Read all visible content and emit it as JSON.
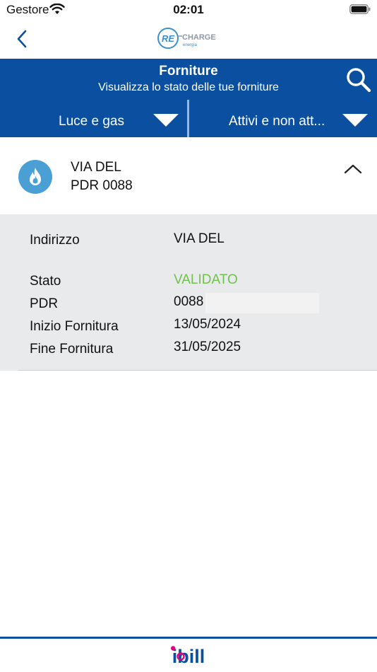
{
  "status_bar": {
    "carrier": "Gestore",
    "time": "02:01"
  },
  "nav": {
    "brand_logo": "RE-CHARGE energia logo",
    "icons": [
      "chevron-left-icon",
      "search-icon"
    ]
  },
  "header": {
    "title": "Forniture",
    "subtitle": "Visualizza lo stato delle tue forniture",
    "filters": [
      {
        "label": "Luce e gas"
      },
      {
        "label": "Attivi e non att..."
      }
    ]
  },
  "supply": {
    "icon": "flame-icon",
    "address": "VIA DEL",
    "pdr_line": "PDR 0088",
    "details": {
      "address_label": "Indirizzo",
      "address_value": "VIA DEL",
      "status_label": "Stato",
      "status_value": "VALIDATO",
      "pdr_label": "PDR",
      "pdr_value": "0088",
      "start_label": "Inizio Fornitura",
      "start_value": "13/05/2024",
      "end_label": "Fine Fornitura",
      "end_value": "31/05/2025"
    }
  },
  "footer": {
    "logo": "iBill"
  },
  "colors": {
    "primary_blue": "#0a4fa0",
    "badge_blue": "#4a9fd4",
    "status_green": "#6fc24a",
    "details_bg": "#e9eaec",
    "brand_pink": "#e6007e"
  }
}
